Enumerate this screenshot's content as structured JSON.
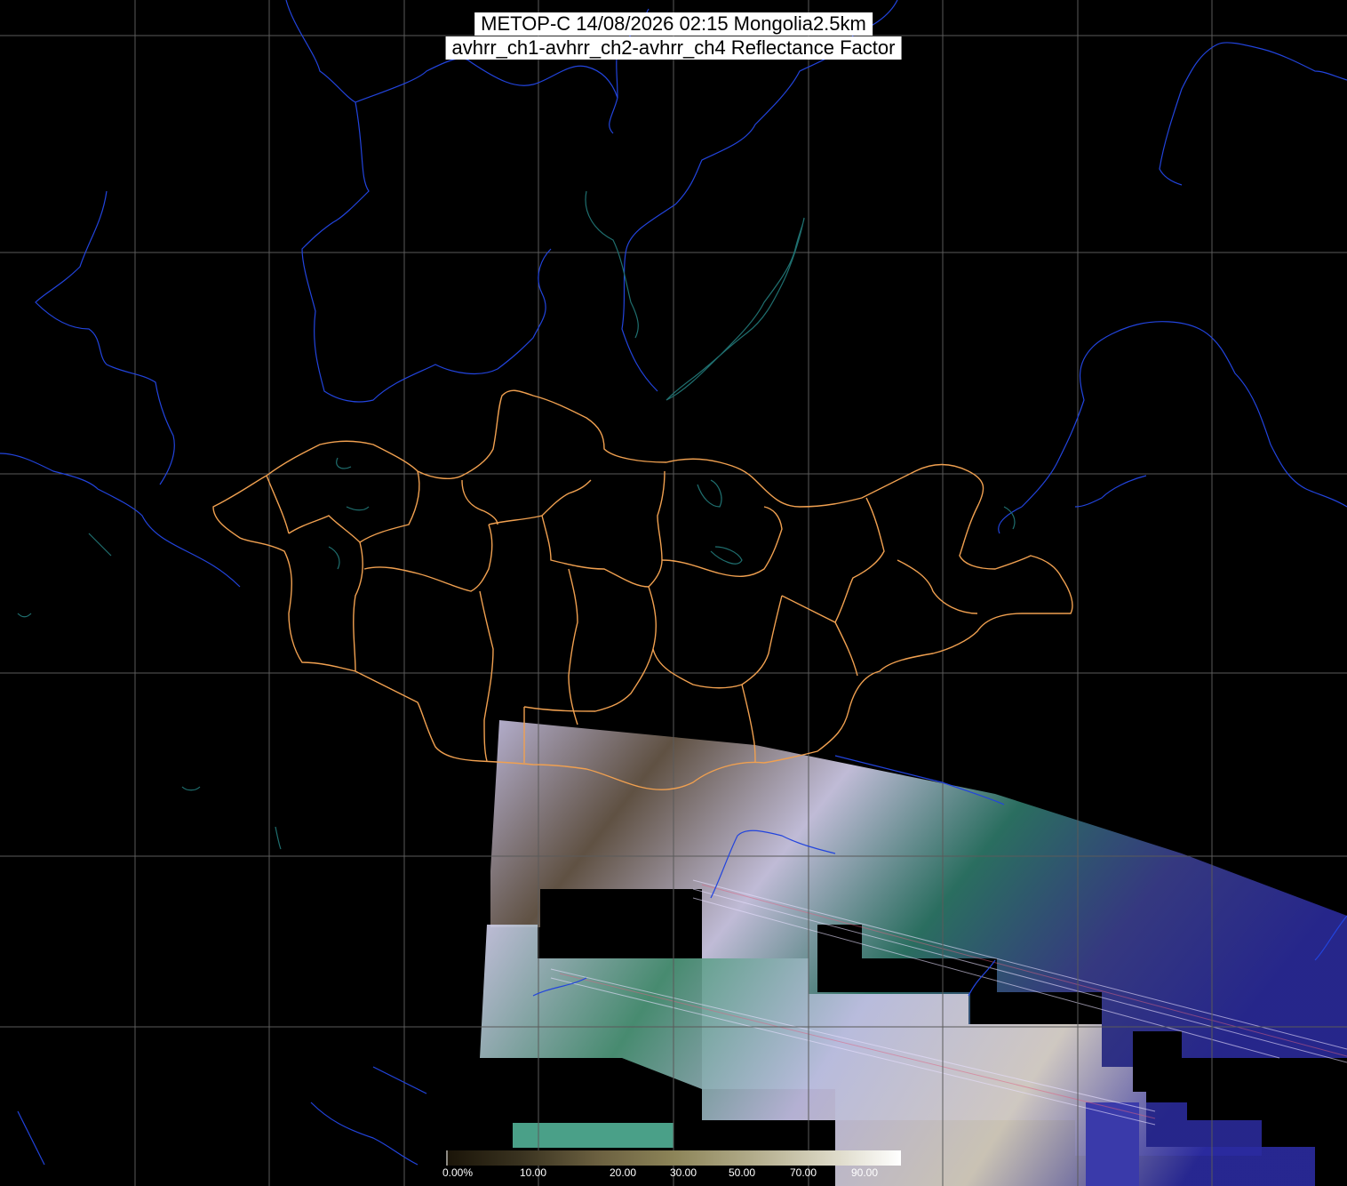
{
  "map": {
    "title_line1": "METOP-C 14/08/2026 02:15 Mongolia2.5km",
    "title_line2": "avhrr_ch1-avhrr_ch2-avhrr_ch4 Reflectance Factor",
    "colors": {
      "background": "#000000",
      "graticule": "#5a5a5a",
      "coastline_river": "#2244dd",
      "lake": "#1f6f6f",
      "country_border": "#f0a050"
    }
  },
  "colorbar": {
    "tick_labels": [
      "0.00%",
      "10.00",
      "20.00",
      "30.00",
      "50.00",
      "70.00",
      "90.00"
    ],
    "stops": [
      "#1a1408",
      "#3a3320",
      "#6b6040",
      "#8c8458",
      "#b0aa88",
      "#d8d4c0",
      "#ffffff"
    ]
  }
}
